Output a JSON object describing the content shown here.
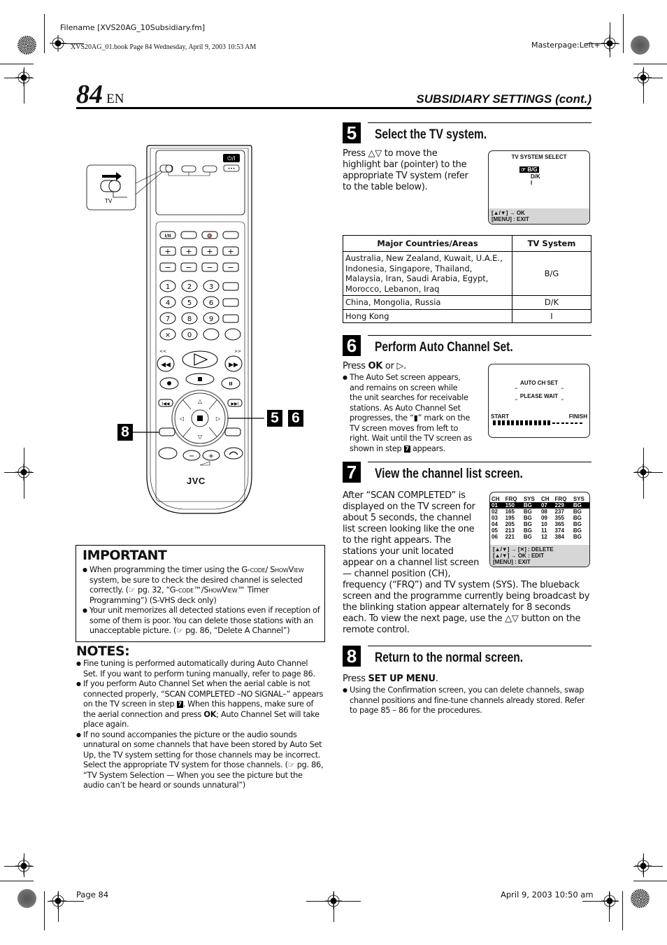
{
  "print_marks": {
    "filename": "Filename [XVS20AG_10Subsidiary.fm]",
    "book_line": "XVS20AG_01.book  Page 84  Wednesday, April 9, 2003  10:53 AM",
    "masterpage": "Masterpage:Left+",
    "footer_page": "Page 84",
    "footer_date": "April 9, 2003 10:50 am"
  },
  "header": {
    "page_number": "84",
    "language": "EN",
    "section_title": "SUBSIDIARY SETTINGS (cont.)"
  },
  "remote": {
    "brand": "JVC",
    "switch_label": "TV",
    "callouts": [
      "8",
      "5",
      "6"
    ],
    "number_keys": [
      "1",
      "2",
      "3",
      "4",
      "5",
      "6",
      "7",
      "8",
      "9",
      "0"
    ]
  },
  "steps": [
    {
      "number": "5",
      "title": "Select the TV system.",
      "text": "Press △▽ to move the highlight bar (pointer) to the appropriate TV system (refer to the table below).",
      "screen": {
        "title": "TV SYSTEM SELECT",
        "options": [
          "B/G",
          "D/K",
          "I"
        ],
        "selected": "B/G",
        "pointer_icon": "☞",
        "footer": [
          "[▲/▼] → OK",
          "[MENU] : EXIT"
        ]
      }
    },
    {
      "number": "6",
      "title": "Perform Auto Channel Set.",
      "press_prefix": "Press ",
      "press_key": "OK",
      "press_suffix": " or ▷.",
      "bullet": "The Auto Set screen appears, and remains on screen while the unit searches for receivable stations. As Auto Channel Set progresses, the “▮” mark on the TV screen moves from left to right. Wait until the TV screen as shown in step",
      "bullet_step_ref": "7",
      "bullet_suffix": " appears.",
      "screen": {
        "line1": "AUTO CH SET",
        "line2": "PLEASE WAIT",
        "start_label": "START",
        "finish_label": "FINISH",
        "progress": 0.65
      }
    },
    {
      "number": "7",
      "title": "View the channel list screen.",
      "text_wrapped": "After “SCAN COMPLETED” is displayed on the TV screen for about 5 seconds, the channel list screen looking like the one to the right appears. The stations your unit located appear on a channel list screen — channel position (CH),",
      "text_full": "frequency (“FRQ”) and TV system (SYS). The blueback screen and the programme currently being broadcast by the blinking station appear alternately for 8 seconds each. To view the next page, use the △▽ button on the remote control.",
      "screen": {
        "headers": [
          "CH",
          "FRQ",
          "SYS",
          "CH",
          "FRQ",
          "SYS"
        ],
        "rows": [
          [
            "01",
            "150",
            "BG",
            "07",
            "229",
            "BG"
          ],
          [
            "02",
            "165",
            "BG",
            "08",
            "237",
            "BG"
          ],
          [
            "03",
            "195",
            "BG",
            "09",
            "355",
            "BG"
          ],
          [
            "04",
            "205",
            "BG",
            "10",
            "365",
            "BG"
          ],
          [
            "05",
            "213",
            "BG",
            "11",
            "374",
            "BG"
          ],
          [
            "06",
            "221",
            "BG",
            "12",
            "384",
            "BG"
          ]
        ],
        "highlighted_row": 0,
        "footer": [
          "[▲/▼] → [✕] : DELETE",
          "[▲/▼] → OK : EDIT",
          "[MENU] : EXIT"
        ]
      }
    },
    {
      "number": "8",
      "title": "Return to the normal screen.",
      "press_prefix": "Press ",
      "press_key": "SET UP MENU",
      "press_suffix": ".",
      "bullet": "Using the Confirmation screen, you can delete channels, swap channel positions and fine-tune channels already stored. Refer to page 85 – 86 for the procedures."
    }
  ],
  "tv_table": {
    "headers": [
      "Major Countries/Areas",
      "TV System"
    ],
    "rows": [
      [
        "Australia, New Zealand, Kuwait, U.A.E., Indonesia, Singapore, Thailand, Malaysia, Iran, Saudi Arabia, Egypt, Morocco, Lebanon, Iraq",
        "B/G"
      ],
      [
        "China, Mongolia, Russia",
        "D/K"
      ],
      [
        "Hong Kong",
        "I"
      ]
    ]
  },
  "important": {
    "title": "IMPORTANT",
    "items": [
      "When programming the timer using the G-CODE/ SHOWVIEW system, be sure to check the desired channel is selected correctly. (☞ pg. 32, “G-CODE™/SHOWVIEW™ Timer Programming”) (S-VHS deck only)",
      "Your unit memorizes all detected stations even if reception of some of them is poor. You can delete those stations with an unacceptable picture. (☞ pg. 86, “Delete A Channel”)"
    ]
  },
  "notes": {
    "title": "NOTES:",
    "items": [
      "Fine tuning is performed automatically during Auto Channel Set. If you want to perform tuning manually, refer to page 86.",
      "If you perform Auto Channel Set when the aerial cable is not connected properly, “SCAN COMPLETED –NO SIGNAL–” appears on the TV screen in step 7. When this happens, make sure of the aerial connection and press OK; Auto Channel Set will take place again.",
      "If no sound accompanies the picture or the audio sounds unnatural on some channels that have been stored by Auto Set Up, the TV system setting for those channels may be incorrect. Select the appropriate TV system for those channels. (☞ pg. 86, “TV System Selection — When you see the picture but the audio can’t be heard or sounds unnatural”)"
    ]
  }
}
